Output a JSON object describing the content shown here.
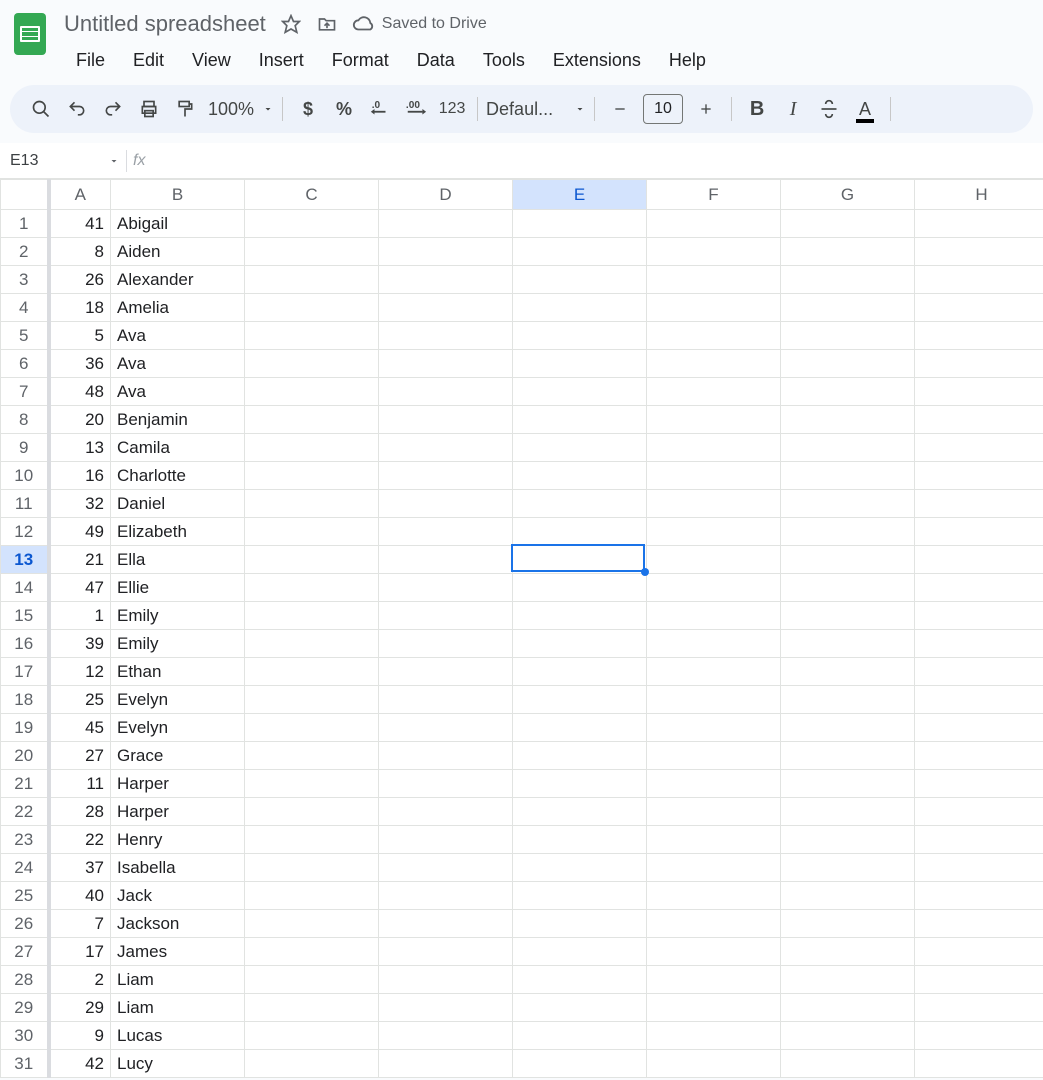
{
  "header": {
    "title": "Untitled spreadsheet",
    "drive_status": "Saved to Drive"
  },
  "menubar": [
    "File",
    "Edit",
    "View",
    "Insert",
    "Format",
    "Data",
    "Tools",
    "Extensions",
    "Help"
  ],
  "toolbar": {
    "zoom": "100%",
    "number_format_label": "123",
    "font_name": "Defaul...",
    "font_size": "10",
    "text_color": "#000000"
  },
  "formula_bar": {
    "cell_ref": "E13",
    "fx_label": "fx",
    "formula_value": ""
  },
  "grid": {
    "columns": [
      "A",
      "B",
      "C",
      "D",
      "E",
      "F",
      "G",
      "H"
    ],
    "selected_cell": {
      "row": 13,
      "col": "E",
      "col_index": 4
    },
    "rows": [
      {
        "n": 1,
        "A": "41",
        "B": "Abigail"
      },
      {
        "n": 2,
        "A": "8",
        "B": "Aiden"
      },
      {
        "n": 3,
        "A": "26",
        "B": "Alexander"
      },
      {
        "n": 4,
        "A": "18",
        "B": "Amelia"
      },
      {
        "n": 5,
        "A": "5",
        "B": "Ava"
      },
      {
        "n": 6,
        "A": "36",
        "B": "Ava"
      },
      {
        "n": 7,
        "A": "48",
        "B": "Ava"
      },
      {
        "n": 8,
        "A": "20",
        "B": "Benjamin"
      },
      {
        "n": 9,
        "A": "13",
        "B": "Camila"
      },
      {
        "n": 10,
        "A": "16",
        "B": "Charlotte"
      },
      {
        "n": 11,
        "A": "32",
        "B": "Daniel"
      },
      {
        "n": 12,
        "A": "49",
        "B": "Elizabeth"
      },
      {
        "n": 13,
        "A": "21",
        "B": "Ella"
      },
      {
        "n": 14,
        "A": "47",
        "B": "Ellie"
      },
      {
        "n": 15,
        "A": "1",
        "B": "Emily"
      },
      {
        "n": 16,
        "A": "39",
        "B": "Emily"
      },
      {
        "n": 17,
        "A": "12",
        "B": "Ethan"
      },
      {
        "n": 18,
        "A": "25",
        "B": "Evelyn"
      },
      {
        "n": 19,
        "A": "45",
        "B": "Evelyn"
      },
      {
        "n": 20,
        "A": "27",
        "B": "Grace"
      },
      {
        "n": 21,
        "A": "11",
        "B": "Harper"
      },
      {
        "n": 22,
        "A": "28",
        "B": "Harper"
      },
      {
        "n": 23,
        "A": "22",
        "B": "Henry"
      },
      {
        "n": 24,
        "A": "37",
        "B": "Isabella"
      },
      {
        "n": 25,
        "A": "40",
        "B": "Jack"
      },
      {
        "n": 26,
        "A": "7",
        "B": "Jackson"
      },
      {
        "n": 27,
        "A": "17",
        "B": "James"
      },
      {
        "n": 28,
        "A": "2",
        "B": "Liam"
      },
      {
        "n": 29,
        "A": "29",
        "B": "Liam"
      },
      {
        "n": 30,
        "A": "9",
        "B": "Lucas"
      },
      {
        "n": 31,
        "A": "42",
        "B": "Lucy"
      }
    ]
  }
}
